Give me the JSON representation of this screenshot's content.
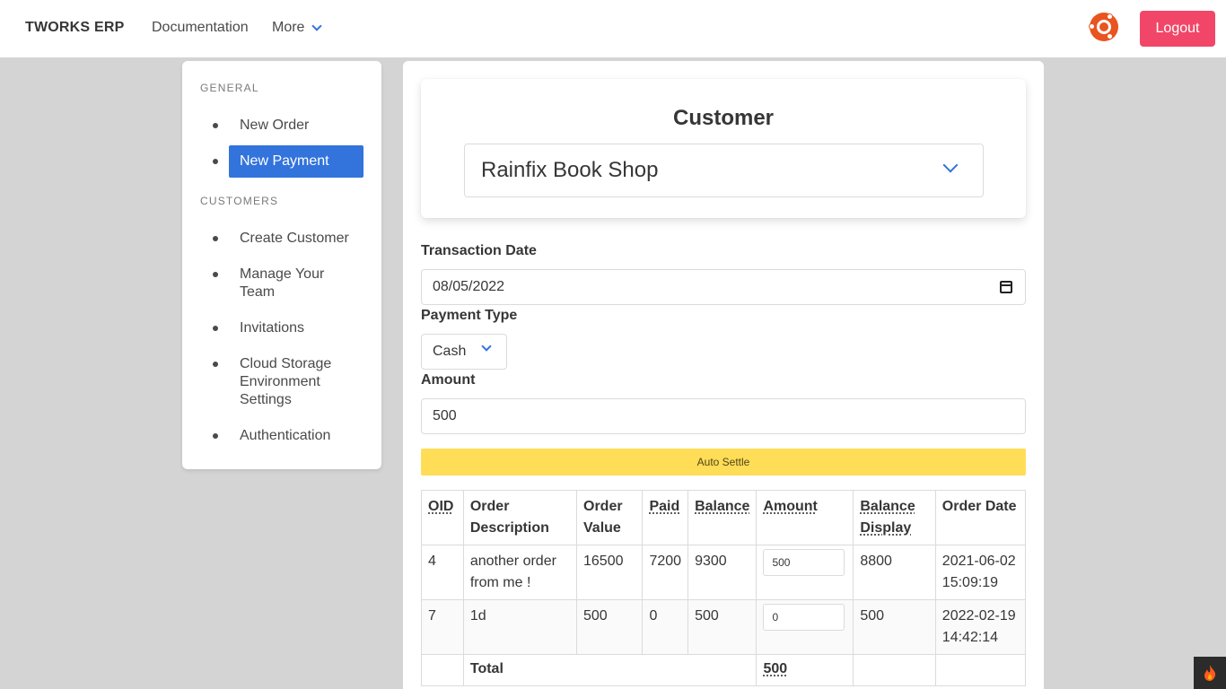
{
  "navbar": {
    "brand": "TWORKS ERP",
    "documentation": "Documentation",
    "more": "More",
    "logout": "Logout",
    "ubuntu_icon": "ubuntu-icon",
    "colors": {
      "logout": "#f14668",
      "accent": "#3273dc",
      "ubuntu": "#e95420"
    }
  },
  "sidebar": {
    "general_label": "GENERAL",
    "general_items": [
      {
        "label": "New Order",
        "active": false
      },
      {
        "label": "New Payment",
        "active": true
      }
    ],
    "customers_label": "CUSTOMERS",
    "customers_items": [
      {
        "label": "Create Customer"
      },
      {
        "label": "Manage Your Team"
      },
      {
        "label": "Invitations"
      },
      {
        "label": "Cloud Storage Environment Settings"
      },
      {
        "label": "Authentication"
      }
    ]
  },
  "customer": {
    "title": "Customer",
    "selected": "Rainfix Book Shop"
  },
  "form": {
    "transaction_date_label": "Transaction Date",
    "transaction_date": "08/05/2022",
    "payment_type_label": "Payment Type",
    "payment_type": "Cash",
    "amount_label": "Amount",
    "amount": "500",
    "auto_settle": "Auto Settle"
  },
  "table": {
    "headers": [
      "OID",
      "Order Description",
      "Order Value",
      "Paid",
      "Balance",
      "Amount",
      "Balance Display",
      "Order Date"
    ],
    "rows": [
      {
        "oid": "4",
        "description": "another order from me !",
        "value": "16500",
        "paid": "7200",
        "balance": "9300",
        "amount": "500",
        "balance_display": "8800",
        "date": "2021-06-02 15:09:19"
      },
      {
        "oid": "7",
        "description": "1d",
        "value": "500",
        "paid": "0",
        "balance": "500",
        "amount": "0",
        "balance_display": "500",
        "date": "2022-02-19 14:42:14"
      }
    ],
    "total_label": "Total",
    "total_amount": "500"
  },
  "corner": {
    "icon": "flame-icon"
  }
}
